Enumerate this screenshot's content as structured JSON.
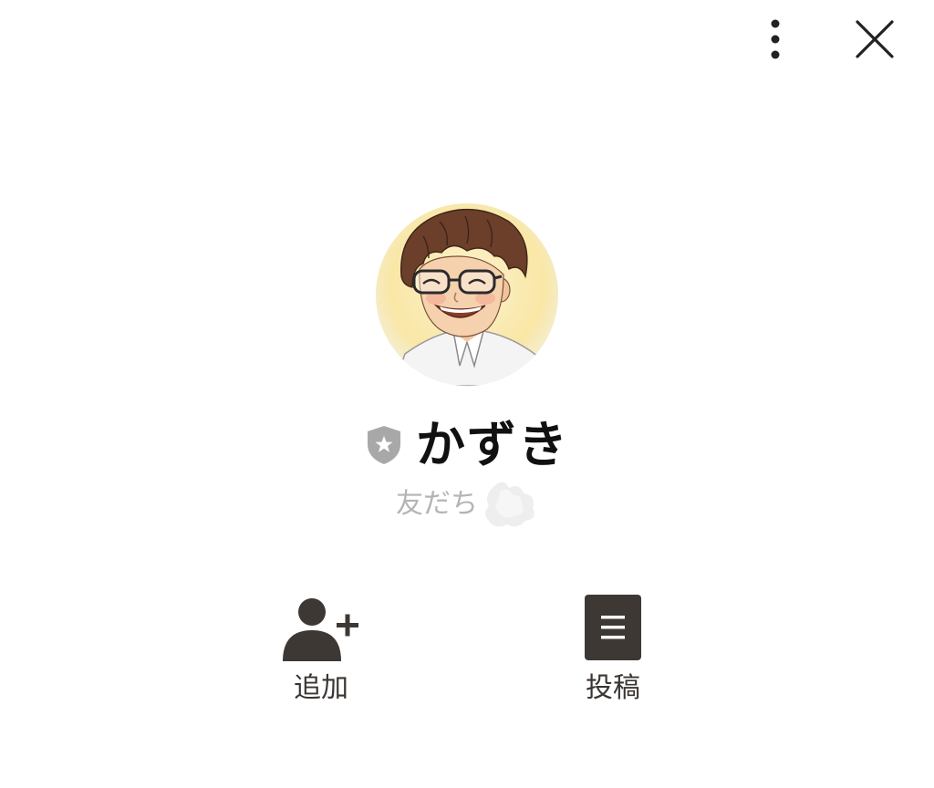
{
  "header": {
    "more_icon": "more-vertical-icon",
    "close_icon": "close-icon"
  },
  "profile": {
    "name": "かずき",
    "badge_icon": "shield-star-icon",
    "status": "友だち",
    "status_decoration_icon": "scribble-blob-icon",
    "avatar": "illustrated-portrait"
  },
  "actions": [
    {
      "label": "追加",
      "icon": "add-friend-icon"
    },
    {
      "label": "投稿",
      "icon": "post-icon"
    }
  ],
  "colors": {
    "icon_dark": "#3e3834",
    "badge": "#a8a8a8",
    "status_text": "#b4b4b4",
    "name_text": "#111111"
  }
}
